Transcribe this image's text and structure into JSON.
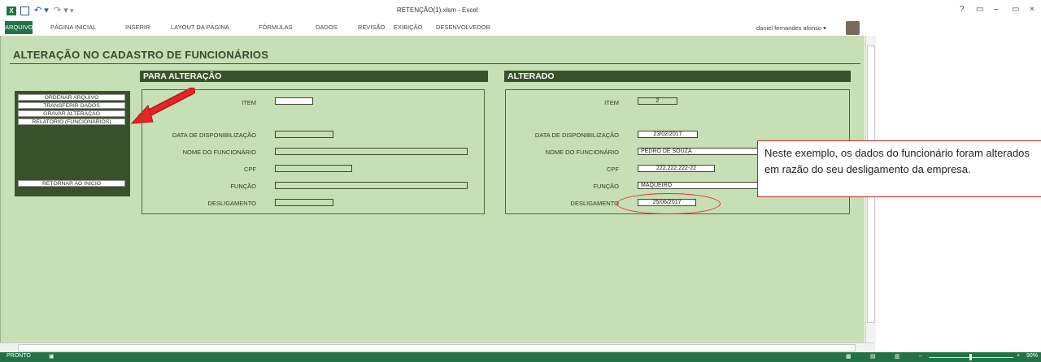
{
  "window": {
    "title": "RETENÇÃO(1).xlsm - Excel",
    "user": "daniel fernandes afonso",
    "controls": [
      "?",
      "▭",
      "–",
      "▭",
      "×"
    ]
  },
  "ribbon": {
    "tabs": [
      "ARQUIVO",
      "PÁGINA INICIAL",
      "INSERIR",
      "LAYOUT DA PÁGINA",
      "FÓRMULAS",
      "DADOS",
      "REVISÃO",
      "EXIBIÇÃO",
      "DESENVOLVEDOR"
    ]
  },
  "sheet": {
    "title": "ALTERAÇÃO NO CADASTRO DE FUNCIONÁRIOS",
    "menu": {
      "buttons": [
        "ORDENAR ARQUIVO",
        "TRANSFERIR DADOS",
        "GRAVAR ALTERAÇÃO",
        "RELATÓRIO (FUNCIONÁRIOS)"
      ],
      "return_button": "RETORNAR AO INÍCIO"
    },
    "para_alteracao": {
      "header": "PARA ALTERAÇÃO",
      "labels": {
        "item": "ITEM",
        "data": "DATA DE DISPONIBILIZAÇÃO",
        "nome": "NOME DO FUNCIONÁRIO",
        "cpf": "CPF",
        "funcao": "FUNÇÃO",
        "desligamento": "DESLIGAMENTO"
      },
      "values": {
        "item": "",
        "data": "",
        "nome": "",
        "cpf": "",
        "funcao": "",
        "desligamento": ""
      }
    },
    "alterado": {
      "header": "ALTERADO",
      "labels": {
        "item": "ITEM",
        "data": "DATA DE DISPONIBILIZAÇÃO",
        "nome": "NOME DO FUNCIONÁRIO",
        "cpf": "CPF",
        "funcao": "FUNÇÃO",
        "desligamento": "DESLIGAMENTO"
      },
      "values": {
        "item": "2",
        "data": "23/02/2017",
        "nome": "PEDRO DE SOUZA",
        "cpf": "222.222.222-22",
        "funcao": "MAQUEIRO",
        "desligamento": "25/06/2017"
      }
    },
    "callout": "Neste exemplo, os dados do funcionário foram alterados em razão do seu desligamento da empresa."
  },
  "status": {
    "mode": "PRONTO",
    "zoom": "90%"
  },
  "colors": {
    "accent": "#217346",
    "sheet_bg": "#c6dfb4",
    "section_bar": "#38522b",
    "highlight": "#e03030"
  }
}
